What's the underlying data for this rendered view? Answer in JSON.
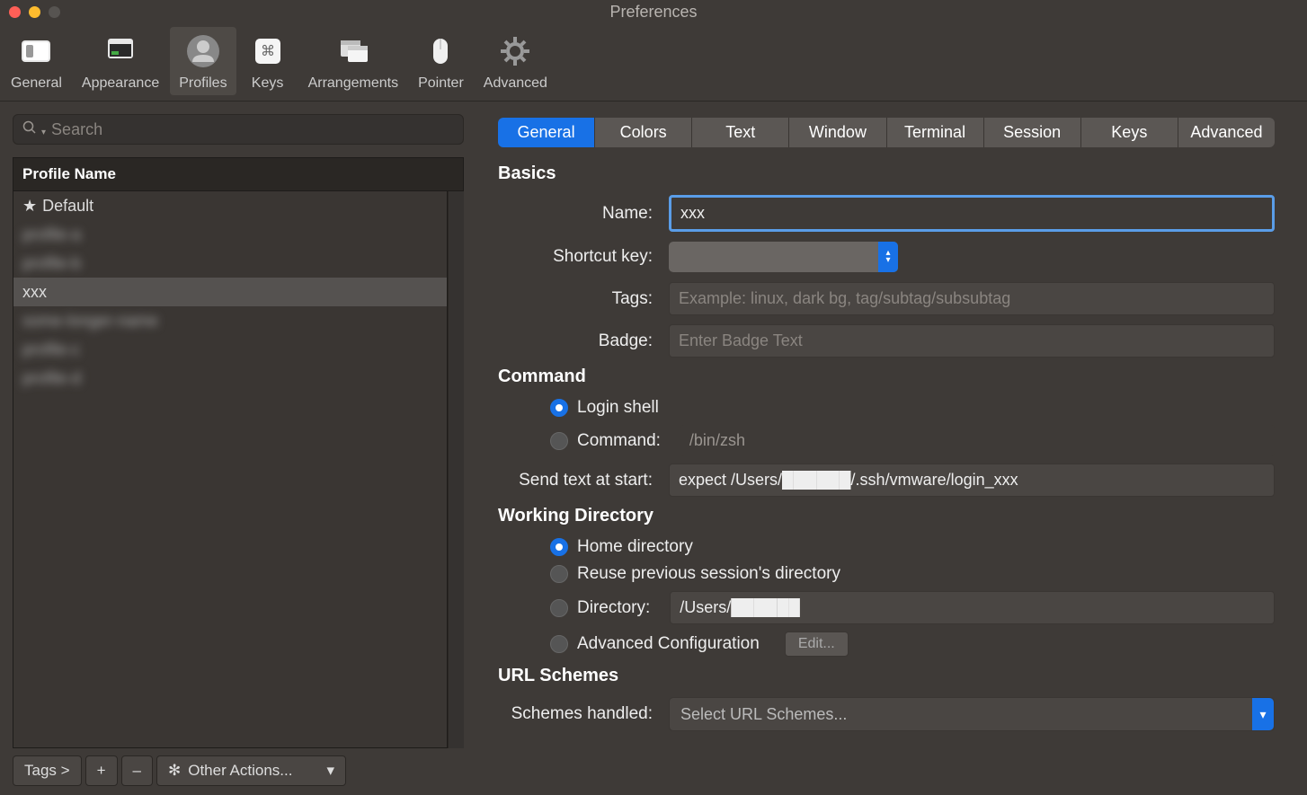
{
  "window": {
    "title": "Preferences"
  },
  "toolbar": {
    "items": [
      {
        "label": "General"
      },
      {
        "label": "Appearance"
      },
      {
        "label": "Profiles"
      },
      {
        "label": "Keys"
      },
      {
        "label": "Arrangements"
      },
      {
        "label": "Pointer"
      },
      {
        "label": "Advanced"
      }
    ],
    "active_index": 2
  },
  "sidebar": {
    "search_placeholder": "Search",
    "header": "Profile Name",
    "profiles": [
      {
        "label": "Default",
        "default": true,
        "blurred": false
      },
      {
        "label": "profile-a",
        "blurred": true
      },
      {
        "label": "profile-b",
        "blurred": true
      },
      {
        "label": "xxx",
        "selected": true,
        "blurred": false
      },
      {
        "label": "some-longer-name",
        "blurred": true
      },
      {
        "label": "profile-c",
        "blurred": true
      },
      {
        "label": "profile-d",
        "blurred": true
      }
    ],
    "bottom": {
      "tags": "Tags >",
      "plus": "+",
      "minus": "–",
      "other": "Other Actions..."
    }
  },
  "tabs": [
    "General",
    "Colors",
    "Text",
    "Window",
    "Terminal",
    "Session",
    "Keys",
    "Advanced"
  ],
  "active_tab": 0,
  "form": {
    "basics_title": "Basics",
    "name_label": "Name:",
    "name_value": "xxx",
    "shortcut_label": "Shortcut key:",
    "tags_label": "Tags:",
    "tags_placeholder": "Example: linux, dark bg, tag/subtag/subsubtag",
    "badge_label": "Badge:",
    "badge_placeholder": "Enter Badge Text",
    "command_title": "Command",
    "login_shell_label": "Login shell",
    "command_label": "Command:",
    "command_value": "/bin/zsh",
    "send_text_label": "Send text at start:",
    "send_text_value": "expect /Users/██████/.ssh/vmware/login_xxx",
    "workdir_title": "Working Directory",
    "homedir_label": "Home directory",
    "reuse_label": "Reuse previous session's directory",
    "directory_label": "Directory:",
    "directory_value": "/Users/██████",
    "advcfg_label": "Advanced Configuration",
    "edit_btn": "Edit...",
    "url_title": "URL Schemes",
    "schemes_label": "Schemes handled:",
    "schemes_value": "Select URL Schemes..."
  }
}
